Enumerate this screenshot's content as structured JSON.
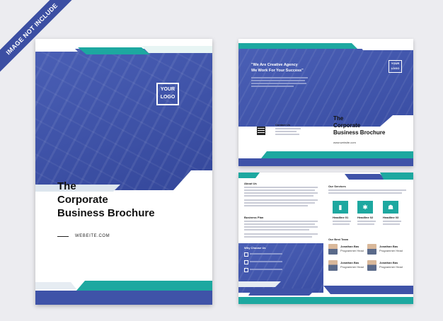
{
  "ribbon": {
    "text": "IMAGE NOT INCLUDE"
  },
  "cover": {
    "logo_line1": "YOUR",
    "logo_line2": "LOGO",
    "title_line1": "The",
    "title_line2": "Corporate",
    "title_line3": "Business Brochure",
    "website": "WEBEITE.COM"
  },
  "back_page": {
    "headline_line1": "\"We Are Creative Agency",
    "headline_line2": "We Work For Your Success\"",
    "logo_line1": "YOUR",
    "logo_line2": "LOGO",
    "contact_heading": "Contact Us",
    "title_line1": "The",
    "title_line2": "Corporate",
    "title_line3": "Business Brochure",
    "website": "www.website.com"
  },
  "inner_page": {
    "about_heading": "About Us",
    "business_plan_heading": "Business Plan",
    "why_choose_heading": "Why Choose Us",
    "services_heading": "Our Services",
    "headline_1": "Headline 01",
    "headline_2": "Headline 02",
    "headline_3": "Headline 03",
    "team_heading": "Our Best Team",
    "member_name": "Jonathan Bas",
    "member_role": "Programmer Head"
  },
  "colors": {
    "brand_blue": "#3f53a8",
    "brand_teal": "#1da8a0"
  }
}
